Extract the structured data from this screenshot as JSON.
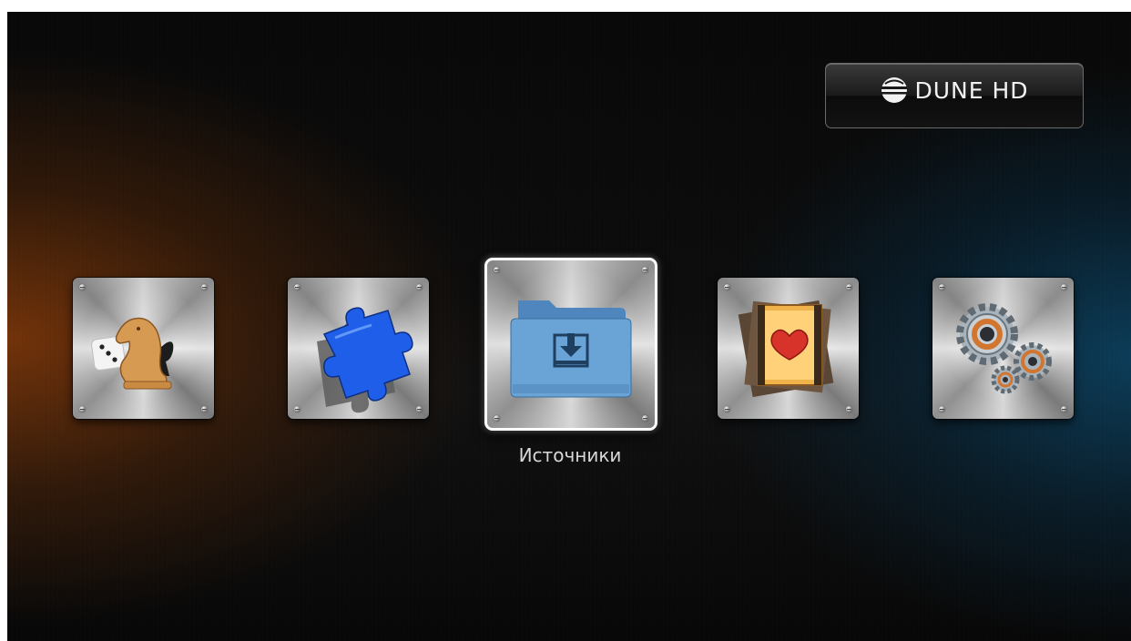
{
  "brand": {
    "logo_text": "DUNE HD",
    "logo_icon": "dune-globe-icon"
  },
  "menu": {
    "items": [
      {
        "id": "games",
        "icon": "chess-knight-dice-icon",
        "selected": false
      },
      {
        "id": "applications",
        "icon": "puzzle-icon",
        "selected": false
      },
      {
        "id": "sources",
        "icon": "folder-download-icon",
        "selected": true,
        "label": "Источники"
      },
      {
        "id": "favorites",
        "icon": "film-heart-icon",
        "selected": false
      },
      {
        "id": "setup",
        "icon": "gears-icon",
        "selected": false
      }
    ],
    "selected_caption": "Источники"
  },
  "colors": {
    "accent_folder": "#6aa3d6",
    "puzzle_blue": "#1e5ee8",
    "heart_red": "#d8332a",
    "selection_border": "#ffffff"
  }
}
